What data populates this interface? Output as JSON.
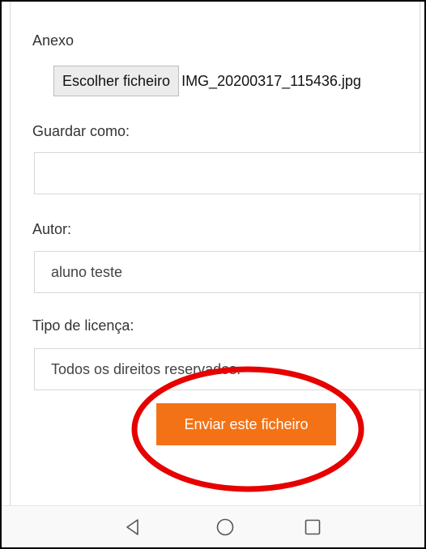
{
  "attachment": {
    "label": "Anexo",
    "choose_button": "Escolher ficheiro",
    "file_name": "IMG_20200317_115436.jpg"
  },
  "save_as": {
    "label": "Guardar como:",
    "value": ""
  },
  "author": {
    "label": "Autor:",
    "value": "aluno teste"
  },
  "license": {
    "label": "Tipo de licença:",
    "value": "Todos os direitos reservados."
  },
  "submit_button": "Enviar este ficheiro",
  "colors": {
    "accent": "#f47216",
    "highlight": "#e60000"
  },
  "navbar": {
    "icons": [
      "back-triangle-icon",
      "home-circle-icon",
      "recents-square-icon"
    ]
  }
}
